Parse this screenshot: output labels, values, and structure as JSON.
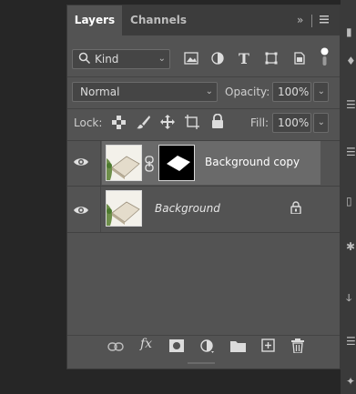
{
  "tabs": [
    {
      "label": "Layers",
      "active": true
    },
    {
      "label": "Channels",
      "active": false
    }
  ],
  "filter": {
    "kind_label": "Kind",
    "icons": [
      "image-filter-icon",
      "adjustment-filter-icon",
      "type-filter-icon",
      "shape-filter-icon",
      "smart-object-filter-icon"
    ]
  },
  "blend": {
    "mode": "Normal",
    "opacity_label": "Opacity:",
    "opacity_value": "100%"
  },
  "lock": {
    "label": "Lock:",
    "fill_label": "Fill:",
    "fill_value": "100%"
  },
  "layers": [
    {
      "name": "Background copy",
      "visible": true,
      "selected": true,
      "has_mask": true
    },
    {
      "name": "Background",
      "visible": true,
      "selected": false,
      "locked": true
    }
  ],
  "bottom_toolbar": {
    "fx_label": "fx"
  },
  "colors": {
    "panel_bg": "#535353",
    "tabbar_bg": "#3c3c3c",
    "selected_row": "#6a6a6a"
  }
}
